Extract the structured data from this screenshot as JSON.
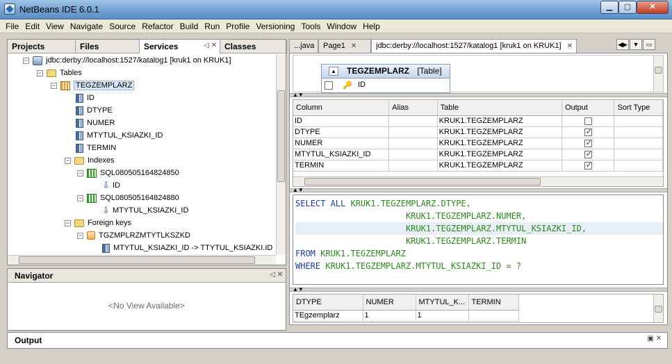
{
  "window": {
    "title": "NetBeans IDE 6.0.1",
    "controls": {
      "minimize": "▁",
      "maximize": "▢",
      "close": "✕"
    }
  },
  "menu": [
    "File",
    "Edit",
    "View",
    "Navigate",
    "Source",
    "Refactor",
    "Build",
    "Run",
    "Profile",
    "Versioning",
    "Tools",
    "Window",
    "Help"
  ],
  "left_panel": {
    "tabs": [
      "Projects",
      "Files",
      "Services",
      "Classes"
    ],
    "active_tab": "Services",
    "tab_controls": "◁ ✕",
    "tree": [
      {
        "label": "jdbc:derby://localhost:1527/katalog1 [kruk1 on KRUK1]",
        "icon": "database-icon",
        "toggle": "−"
      },
      {
        "label": "Tables",
        "icon": "folder-icon",
        "toggle": "−"
      },
      {
        "label": "TEGZEMPLARZ",
        "icon": "table-icon",
        "toggle": "−"
      },
      {
        "label": "ID",
        "icon": "column-icon"
      },
      {
        "label": "DTYPE",
        "icon": "column-icon"
      },
      {
        "label": "NUMER",
        "icon": "column-icon"
      },
      {
        "label": "MTYTUL_KSIAZKI_ID",
        "icon": "column-icon"
      },
      {
        "label": "TERMIN",
        "icon": "column-icon"
      },
      {
        "label": "Indexes",
        "icon": "folder-icon",
        "toggle": "−"
      },
      {
        "label": "SQL080505164824850",
        "icon": "index-icon",
        "toggle": "−"
      },
      {
        "label": "ID",
        "icon": "index-column-icon"
      },
      {
        "label": "SQL080505164824880",
        "icon": "index-icon",
        "toggle": "−"
      },
      {
        "label": "MTYTUL_KSIAZKI_ID",
        "icon": "index-column-icon"
      },
      {
        "label": "Foreign keys",
        "icon": "folder-icon",
        "toggle": "−"
      },
      {
        "label": "TGZMPLRZMTYTLKSZKD",
        "icon": "foreign-key-icon",
        "toggle": "−"
      },
      {
        "label": "MTYTUL_KSIAZKI_ID -> TTYTUL_KSIAZKI.ID",
        "icon": "column-icon"
      }
    ]
  },
  "navigator": {
    "title": "Navigator",
    "empty_text": "<No View Available>",
    "controls": "◁ ✕"
  },
  "editor": {
    "tabs": [
      {
        "label": "...java"
      },
      {
        "label": "Page1",
        "close": "✕"
      },
      {
        "label": "jdbc:derby://localhost:1527/katalog1 [kruk1 on KRUK1]",
        "close": "✕",
        "active": true
      }
    ],
    "diagram": {
      "table_name": "TEGZEMPLARZ",
      "table_kind": "[Table]",
      "first_column": "ID"
    },
    "criteria": {
      "headers": [
        "Column",
        "Alias",
        "Table",
        "Output",
        "Sort Type"
      ],
      "rows": [
        {
          "column": "ID",
          "alias": "",
          "table": "KRUK1.TEGZEMPLARZ",
          "output": false
        },
        {
          "column": "DTYPE",
          "alias": "",
          "table": "KRUK1.TEGZEMPLARZ",
          "output": true
        },
        {
          "column": "NUMER",
          "alias": "",
          "table": "KRUK1.TEGZEMPLARZ",
          "output": true
        },
        {
          "column": "MTYTUL_KSIAZKI_ID",
          "alias": "",
          "table": "KRUK1.TEGZEMPLARZ",
          "output": true
        },
        {
          "column": "TERMIN",
          "alias": "",
          "table": "KRUK1.TEGZEMPLARZ",
          "output": true
        }
      ]
    },
    "sql": [
      {
        "kw": "SELECT ALL ",
        "id": "KRUK1.TEGZEMPLARZ.DTYPE,",
        "pad": ""
      },
      {
        "kw": "",
        "id": "KRUK1.TEGZEMPLARZ.NUMER,",
        "pad": "                      "
      },
      {
        "kw": "",
        "id": "KRUK1.TEGZEMPLARZ.MTYTUL_KSIAZKI_ID,",
        "pad": "                      "
      },
      {
        "kw": "",
        "id": "KRUK1.TEGZEMPLARZ.TERMIN",
        "pad": "                      "
      },
      {
        "kw": "FROM ",
        "id": "KRUK1.TEGZEMPLARZ",
        "pad": ""
      },
      {
        "kw": "WHERE ",
        "id": "KRUK1.TEGZEMPLARZ.MTYTUL_KSIAZKI_ID = ?",
        "pad": ""
      }
    ],
    "results": {
      "headers": [
        "DTYPE",
        "NUMER",
        "MTYTUL_K...",
        "TERMIN"
      ],
      "rows": [
        [
          "TEgzemplarz",
          "1",
          "1",
          ""
        ]
      ]
    }
  },
  "output": {
    "title": "Output",
    "controls": "▣ ✕"
  }
}
